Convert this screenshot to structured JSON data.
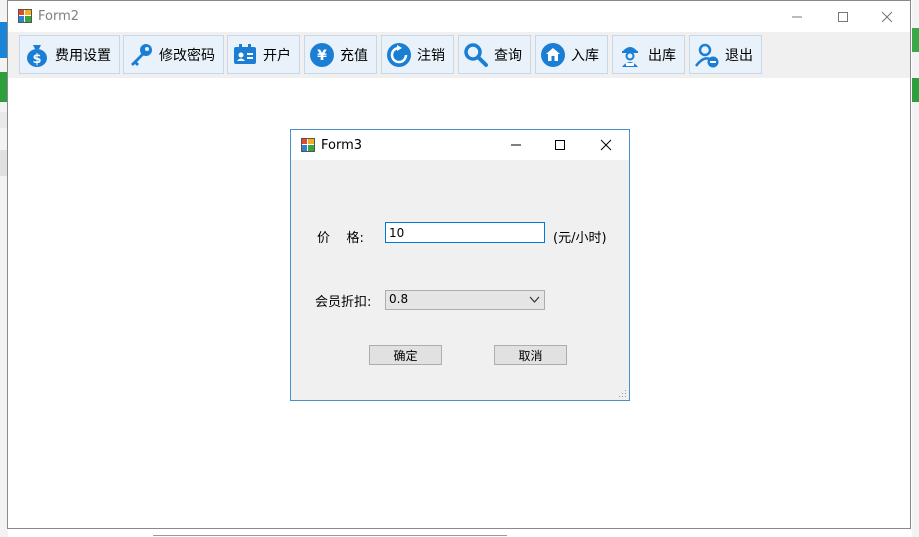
{
  "form2": {
    "title": "Form2",
    "toolbar": [
      {
        "label": "费用设置",
        "icon": "money-bag-icon"
      },
      {
        "label": "修改密码",
        "icon": "key-icon"
      },
      {
        "label": "开户",
        "icon": "id-card-icon"
      },
      {
        "label": "充值",
        "icon": "yen-icon"
      },
      {
        "label": "注销",
        "icon": "refresh-icon"
      },
      {
        "label": "查询",
        "icon": "search-icon"
      },
      {
        "label": "入库",
        "icon": "home-icon"
      },
      {
        "label": "出库",
        "icon": "worker-icon"
      },
      {
        "label": "退出",
        "icon": "user-remove-icon"
      }
    ]
  },
  "form3": {
    "title": "Form3",
    "price_label": "价    格:",
    "price_value": "10",
    "price_unit": "(元/小时)",
    "discount_label": "会员折扣:",
    "discount_value": "0.8",
    "ok_label": "确定",
    "cancel_label": "取消"
  },
  "colors": {
    "toolbar_button_bg": "#e9f2fa",
    "icon_blue": "#1a7fd4",
    "dialog_border": "#4a90d0"
  }
}
